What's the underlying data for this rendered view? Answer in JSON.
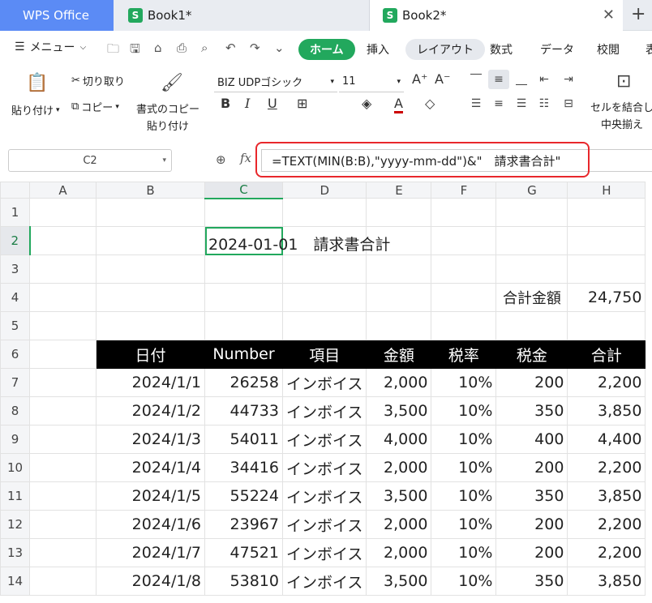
{
  "tabs": [
    {
      "label": "WPS Office"
    },
    {
      "label": "Book1*",
      "icon": "S"
    },
    {
      "label": "Book2*",
      "icon": "S"
    }
  ],
  "menubar": {
    "menu_label": "メニュー",
    "tabs": [
      "ホーム",
      "挿入",
      "レイアウト",
      "数式",
      "データ",
      "校閲",
      "表"
    ]
  },
  "ribbon": {
    "paste_label": "貼り付け",
    "cut_label": "切り取り",
    "copy_label": "コピー",
    "format_copy_line1": "書式のコピー",
    "format_copy_line2": "貼り付け",
    "font_name": "BIZ UDPゴシック",
    "font_size": "11",
    "merge_line1": "セルを結合し",
    "merge_line2": "中央揃え"
  },
  "formula_bar": {
    "name_box": "C2",
    "fx": "fx",
    "formula": "=TEXT(MIN(B:B),\"yyyy-mm-dd\")&\"　請求書合計\""
  },
  "grid": {
    "columns": [
      "A",
      "B",
      "C",
      "D",
      "E",
      "F",
      "G",
      "H"
    ],
    "c2_value": "2024-01-01　請求書合計",
    "g4_label": "合計金額",
    "h4_value": "24,750",
    "table_headers": [
      "日付",
      "Number",
      "項目",
      "金額",
      "税率",
      "税金",
      "合計"
    ],
    "rows": [
      [
        "2024/1/1",
        "26258",
        "インボイス",
        "2,000",
        "10%",
        "200",
        "2,200"
      ],
      [
        "2024/1/2",
        "44733",
        "インボイス",
        "3,500",
        "10%",
        "350",
        "3,850"
      ],
      [
        "2024/1/3",
        "54011",
        "インボイス",
        "4,000",
        "10%",
        "400",
        "4,400"
      ],
      [
        "2024/1/4",
        "34416",
        "インボイス",
        "2,000",
        "10%",
        "200",
        "2,200"
      ],
      [
        "2024/1/5",
        "55224",
        "インボイス",
        "3,500",
        "10%",
        "350",
        "3,850"
      ],
      [
        "2024/1/6",
        "23967",
        "インボイス",
        "2,000",
        "10%",
        "200",
        "2,200"
      ],
      [
        "2024/1/7",
        "47521",
        "インボイス",
        "2,000",
        "10%",
        "200",
        "2,200"
      ],
      [
        "2024/1/8",
        "53810",
        "インボイス",
        "3,500",
        "10%",
        "350",
        "3,850"
      ]
    ]
  },
  "colors": {
    "accent": "#22a85d",
    "wps_tab": "#5b8bf5",
    "highlight": "#e8272b"
  }
}
